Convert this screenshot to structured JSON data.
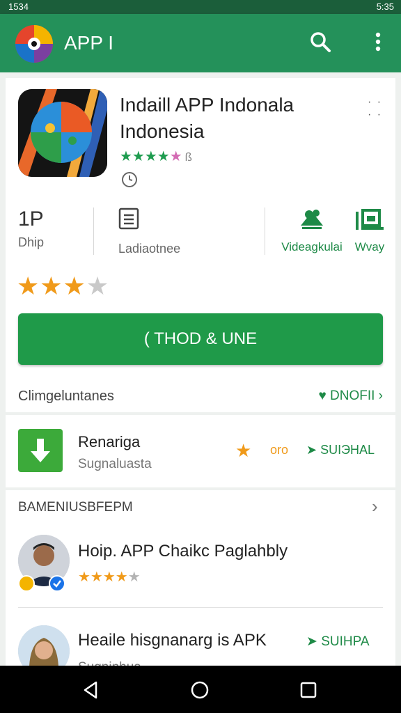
{
  "status_bar": {
    "left": "1534",
    "right": "5:35"
  },
  "app_bar": {
    "title": "APP I"
  },
  "app": {
    "title": "Indaill APP Indonala Indonesia",
    "rating_small": "★★★★",
    "rating_small_partial": "★",
    "rating_small_extra": "ß"
  },
  "stats": [
    {
      "value": "1P",
      "label": "Dhip"
    },
    {
      "label": "Ladiaotnee"
    },
    {
      "label": "Videagkulai"
    },
    {
      "label": "Wvay"
    }
  ],
  "big_rating": {
    "filled": "★★★",
    "empty": "★"
  },
  "install_button": "( THOD & UNE",
  "details_row": {
    "label": "Climgeluntanes",
    "action": "DNOFII ›"
  },
  "download_item": {
    "title": "Renariga",
    "subtitle": "Sugnaluasta",
    "star": "★",
    "count": "oro",
    "action": "SUIЭHAL"
  },
  "reviews_section": {
    "header": "BAMENIUSBFEPM",
    "chevron": "›",
    "reviews": [
      {
        "title": "Hoip. APP Chaikc Paglahbly",
        "stars_filled": "★★★★",
        "stars_empty": "★"
      },
      {
        "title": "Heaile hisgnanarg is APK",
        "subtitle": "Sugninhua",
        "action": "SUIHPA"
      }
    ]
  },
  "colors": {
    "app_bar": "#24915a",
    "status_bar": "#1b5e3a",
    "accent_green": "#1f9a49",
    "star_orange": "#f09a1a"
  }
}
